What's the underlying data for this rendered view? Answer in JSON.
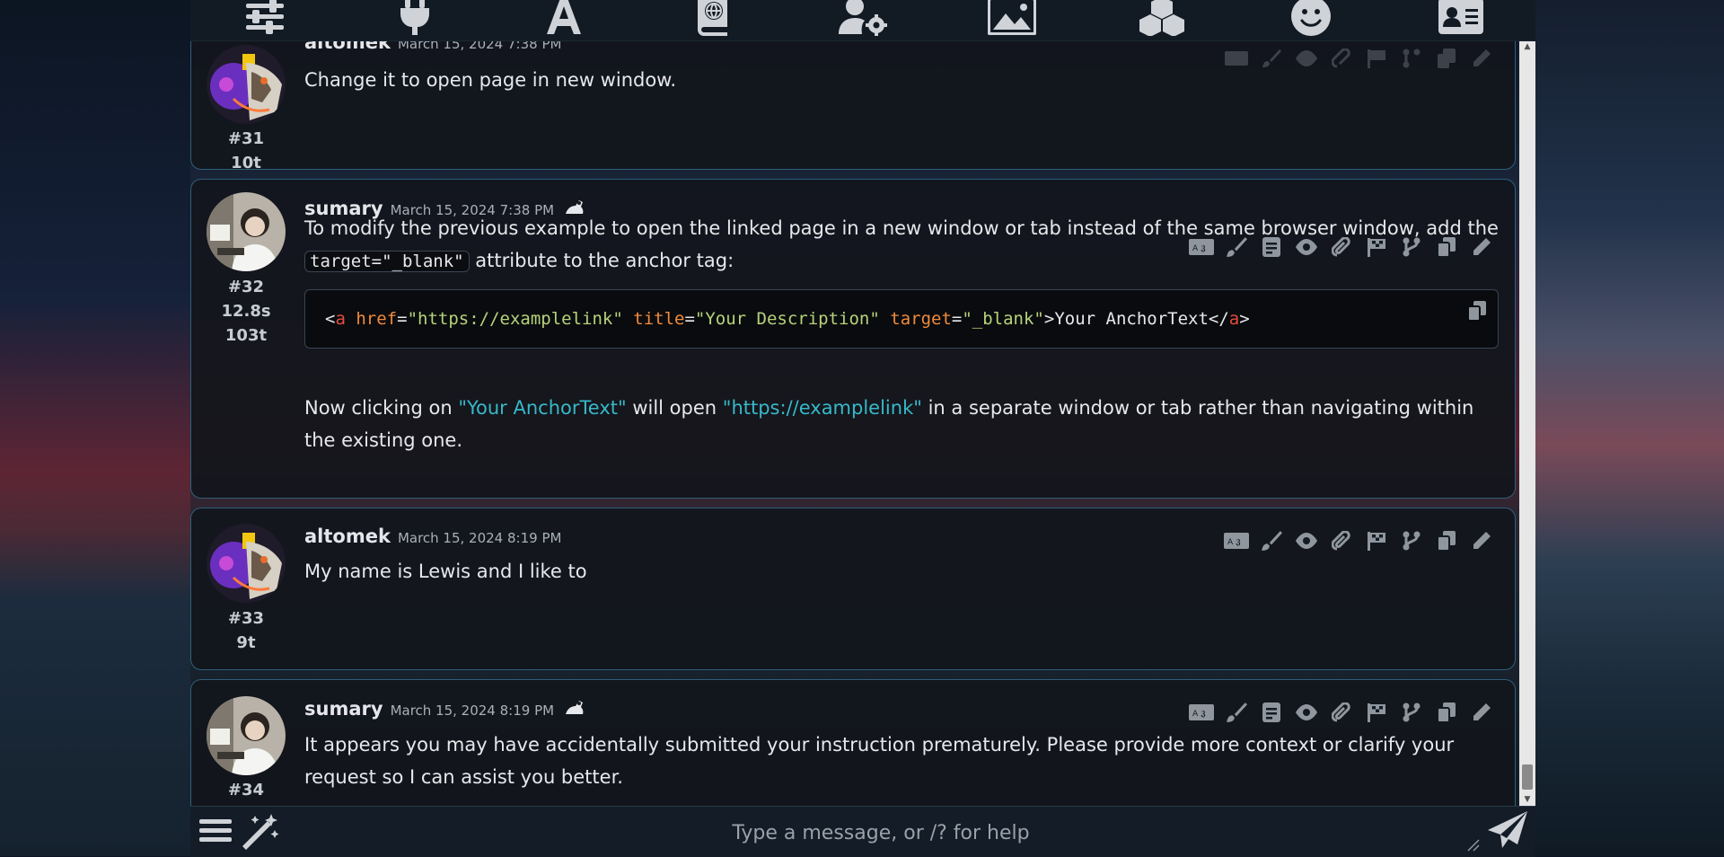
{
  "messages": [
    {
      "id": "#31",
      "tokens": "10t",
      "name": "altomek",
      "time": "March 15, 2024 7:38 PM",
      "text": "Change it to open page in new window."
    },
    {
      "id": "#32",
      "gen_time": "12.8s",
      "tokens": "103t",
      "name": "sumary",
      "time": "March 15, 2024 7:38 PM",
      "p1_a": "To modify the previous example to open the linked page in a new window or tab instead of the same browser window, add the",
      "p1_code": "target=\"_blank\"",
      "p1_b": "attribute to the anchor tag:",
      "code": {
        "lt": "<",
        "tag_open": "a",
        "attr_href": "href",
        "eq": "=",
        "val_href": "\"https://examplelink\"",
        "attr_title": "title",
        "val_title": "\"Your Description\"",
        "attr_target": "target",
        "val_target": "\"_blank\"",
        "gt_text": ">Your AnchorText</",
        "tag_close": "a",
        "gt": ">"
      },
      "p2_a": "Now clicking on",
      "p2_q1": "\"Your AnchorText\"",
      "p2_b": "will open",
      "p2_q2": "\"https://examplelink\"",
      "p2_c": "in a separate window or tab rather than navigating within the existing one."
    },
    {
      "id": "#33",
      "tokens": "9t",
      "name": "altomek",
      "time": "March 15, 2024 8:19 PM",
      "text": "My name is Lewis and I like to"
    },
    {
      "id": "#34",
      "name": "sumary",
      "time": "March 15, 2024 8:19 PM",
      "text": "It appears you may have accidentally submitted your instruction prematurely. Please provide more context or clarify your request so I can assist you better."
    }
  ],
  "send_form": {
    "placeholder": "Type a message, or /? for help"
  },
  "colors": {
    "accent_border": "#2f5f7a",
    "quote": "#36b9c8"
  }
}
